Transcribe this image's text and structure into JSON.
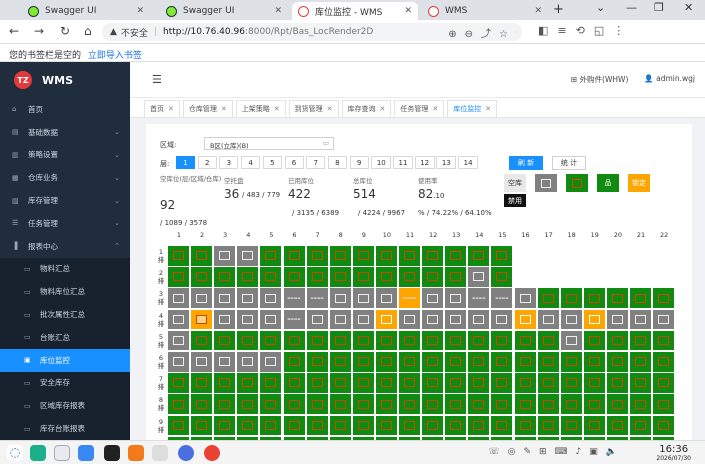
{
  "browser": {
    "tabs": [
      {
        "title": "Swagger UI",
        "icon": "swagger-icon",
        "active": false
      },
      {
        "title": "Swagger UI",
        "icon": "swagger-icon",
        "active": false
      },
      {
        "title": "库位监控 - WMS",
        "icon": "tz-logo-icon",
        "active": true
      },
      {
        "title": "WMS",
        "icon": "tz-logo-icon",
        "active": false
      }
    ],
    "security_label": "不安全",
    "url_host": "http://10.76.40.96",
    "url_path": ":8000/Rpt/Bas_LocRender2D",
    "bookmark_empty_text": "您的书签栏是空的",
    "bookmark_import_link": "立即导入书签"
  },
  "app": {
    "brand": "WMS",
    "logo_text": "TZ",
    "user_location": "外购件(WHW)",
    "user_name": "admin.wgj"
  },
  "sidebar": {
    "items": [
      {
        "label": "首页",
        "icon": "home-icon",
        "type": "top",
        "chevron": false
      },
      {
        "label": "基础数据",
        "icon": "database-icon",
        "type": "top",
        "chevron": true
      },
      {
        "label": "策略设置",
        "icon": "strategy-icon",
        "type": "top",
        "chevron": true
      },
      {
        "label": "仓库业务",
        "icon": "warehouse-icon",
        "type": "top",
        "chevron": true
      },
      {
        "label": "库存管理",
        "icon": "inventory-icon",
        "type": "top",
        "chevron": true
      },
      {
        "label": "任务管理",
        "icon": "task-icon",
        "type": "top",
        "chevron": true
      },
      {
        "label": "报表中心",
        "icon": "report-icon",
        "type": "top",
        "chevron": true,
        "expanded": true
      },
      {
        "label": "物料汇总",
        "icon": "doc-icon",
        "type": "sub"
      },
      {
        "label": "物料库位汇总",
        "icon": "doc-icon",
        "type": "sub"
      },
      {
        "label": "批次属性汇总",
        "icon": "doc-icon",
        "type": "sub"
      },
      {
        "label": "台账汇总",
        "icon": "doc-icon",
        "type": "sub"
      },
      {
        "label": "库位监控",
        "icon": "monitor-icon",
        "type": "sub",
        "selected": true
      },
      {
        "label": "安全库存",
        "icon": "doc-icon",
        "type": "sub"
      },
      {
        "label": "区域库存报表",
        "icon": "doc-icon",
        "type": "sub"
      },
      {
        "label": "库存台账报表",
        "icon": "doc-icon",
        "type": "sub"
      }
    ]
  },
  "page_tabs": [
    {
      "label": "首页",
      "active": false
    },
    {
      "label": "仓库管理",
      "active": false
    },
    {
      "label": "上架策略",
      "active": false
    },
    {
      "label": "到货管理",
      "active": false
    },
    {
      "label": "库存查询",
      "active": false
    },
    {
      "label": "任务管理",
      "active": false
    },
    {
      "label": "库位监控",
      "active": true
    }
  ],
  "filters": {
    "area_label": "区域:",
    "area_value": "B区(立库)(B)",
    "layer_label": "层:",
    "layers": [
      "1",
      "2",
      "3",
      "4",
      "5",
      "6",
      "7",
      "8",
      "9",
      "10",
      "11",
      "12",
      "13",
      "14"
    ],
    "active_layer": "1",
    "refresh_label": "刷 新",
    "stat_label": "统 计"
  },
  "stats": {
    "empty_locs_label": "空库位(层/区域/仓库)",
    "empty_locs_value": "92",
    "empty_locs_sub": "/ 1089 / 3578",
    "empty_pallet_label": "空托盘",
    "empty_pallet_value": "36",
    "empty_pallet_sub": "/ 483 / 779",
    "used_label": "已用库位",
    "used_value": "422",
    "used_sub": "/ 3135 / 6389",
    "total_label": "总库位",
    "total_value": "514",
    "total_sub": "/ 4224 / 9967",
    "rate_label": "使用率",
    "rate_value": "82",
    "rate_decimal": ".10",
    "rate_sub": "% / 74.22% / 64.10%"
  },
  "legend": {
    "empty_label": "空库",
    "disabled_label": "禁用",
    "lock_label": "锁定",
    "colors": {
      "full": "#108a10",
      "empty": "#e8e8e8",
      "pallet": "#808080",
      "lock": "#ffa500",
      "disabled": "#111111"
    }
  },
  "grid": {
    "columns": [
      "1",
      "2",
      "3",
      "4",
      "5",
      "6",
      "7",
      "8",
      "9",
      "10",
      "11",
      "12",
      "13",
      "14",
      "15",
      "16",
      "17",
      "18",
      "19",
      "20",
      "21",
      "22"
    ],
    "rows": [
      {
        "label": "1排",
        "cells": "GGPPGGGGGGGGGGG"
      },
      {
        "label": "2排",
        "cells": "GGGGGGGGGGGGGPG"
      },
      {
        "label": "3排",
        "cells": "PPPPPDDPPPLPPDDPGGGGGG"
      },
      {
        "label": "4排",
        "cells": "POPPPDPPPOPPPPPOPPOPPP"
      },
      {
        "label": "5排",
        "cells": "PGGGGGGGGGGGGGGGGPGGGG"
      },
      {
        "label": "6排",
        "cells": "PPPPPGGGGGGGGGGGGGGGGG"
      },
      {
        "label": "7排",
        "cells": "GGGGGGGGGGGGGGGGGGGGGG"
      },
      {
        "label": "8排",
        "cells": "GGGGGGGGGGGGGGGGGGGGGG"
      },
      {
        "label": "9排",
        "cells": "GGGGGGGGGGGGGGGGGGGGGG"
      },
      {
        "label": "10排",
        "cells": "GGGGGGGGGGGGGGGGGGGGGG"
      }
    ]
  },
  "taskbar": {
    "time": "16:36",
    "date": "2026/07/30"
  }
}
